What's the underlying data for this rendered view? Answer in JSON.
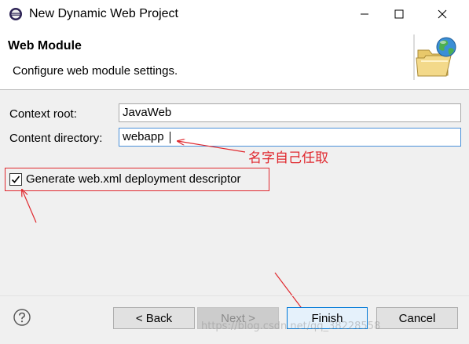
{
  "window": {
    "title": "New Dynamic Web Project",
    "app_icon": "eclipse-icon"
  },
  "header": {
    "title": "Web Module",
    "description": "Configure web module settings.",
    "banner_icon": "web-folder-globe-icon"
  },
  "form": {
    "context_root_label": "Context root:",
    "context_root_value": "JavaWeb",
    "content_directory_label": "Content directory:",
    "content_directory_value": "webapp",
    "generate_web_xml_label": "Generate web.xml deployment descriptor",
    "generate_web_xml_checked": true
  },
  "annotation": {
    "text": "名字自己任取",
    "color": "#e0282e"
  },
  "buttons": {
    "back": "< Back",
    "next": "Next >",
    "finish": "Finish",
    "cancel": "Cancel"
  },
  "watermark": "https://blog.csdn.net/qq_38228558"
}
